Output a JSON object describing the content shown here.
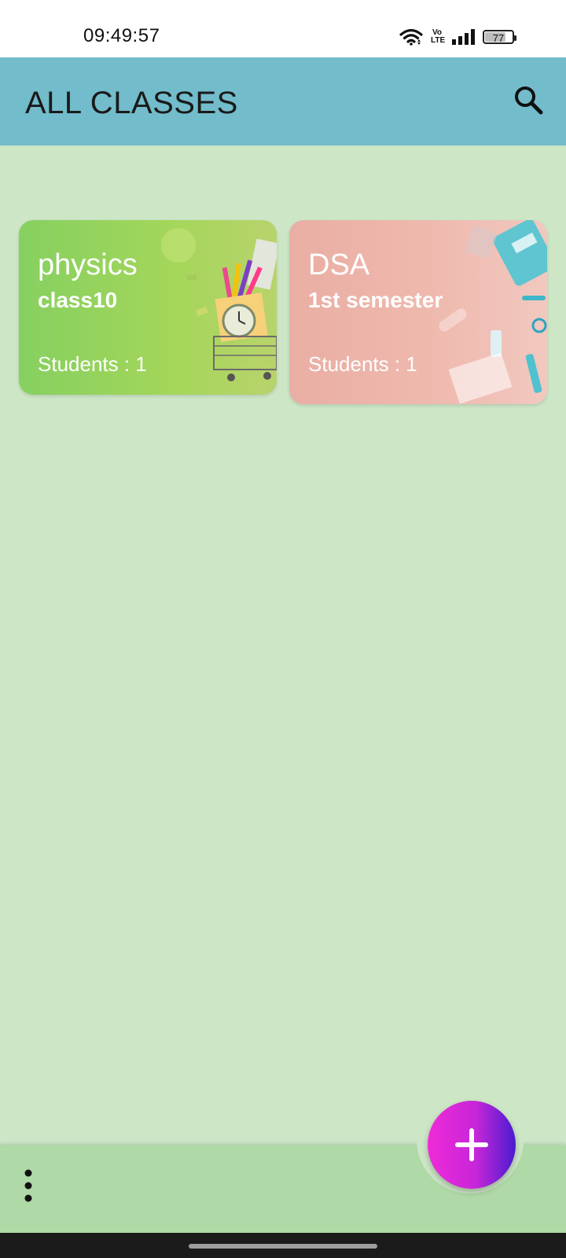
{
  "status_bar": {
    "time": "09:49:57",
    "volte": "Vo\nLTE",
    "battery": "77",
    "battery_level": 77,
    "icons": [
      "wifi-icon",
      "volte-icon",
      "signal-icon",
      "battery-icon"
    ]
  },
  "app_bar": {
    "title": "ALL CLASSES",
    "icon": "search-icon",
    "color": "#72bccb"
  },
  "classes": [
    {
      "name": "physics",
      "subtitle": "class10",
      "students": "Students : 1",
      "color": "#86d060"
    },
    {
      "name": "DSA",
      "subtitle": "1st semester",
      "students": "Students : 1",
      "color": "#e9aea4"
    }
  ],
  "bottom_bar": {
    "menu_icon": "more-vert-icon",
    "fab_icon": "plus-icon",
    "color": "#afd9a6"
  },
  "background": "#cce6c6"
}
